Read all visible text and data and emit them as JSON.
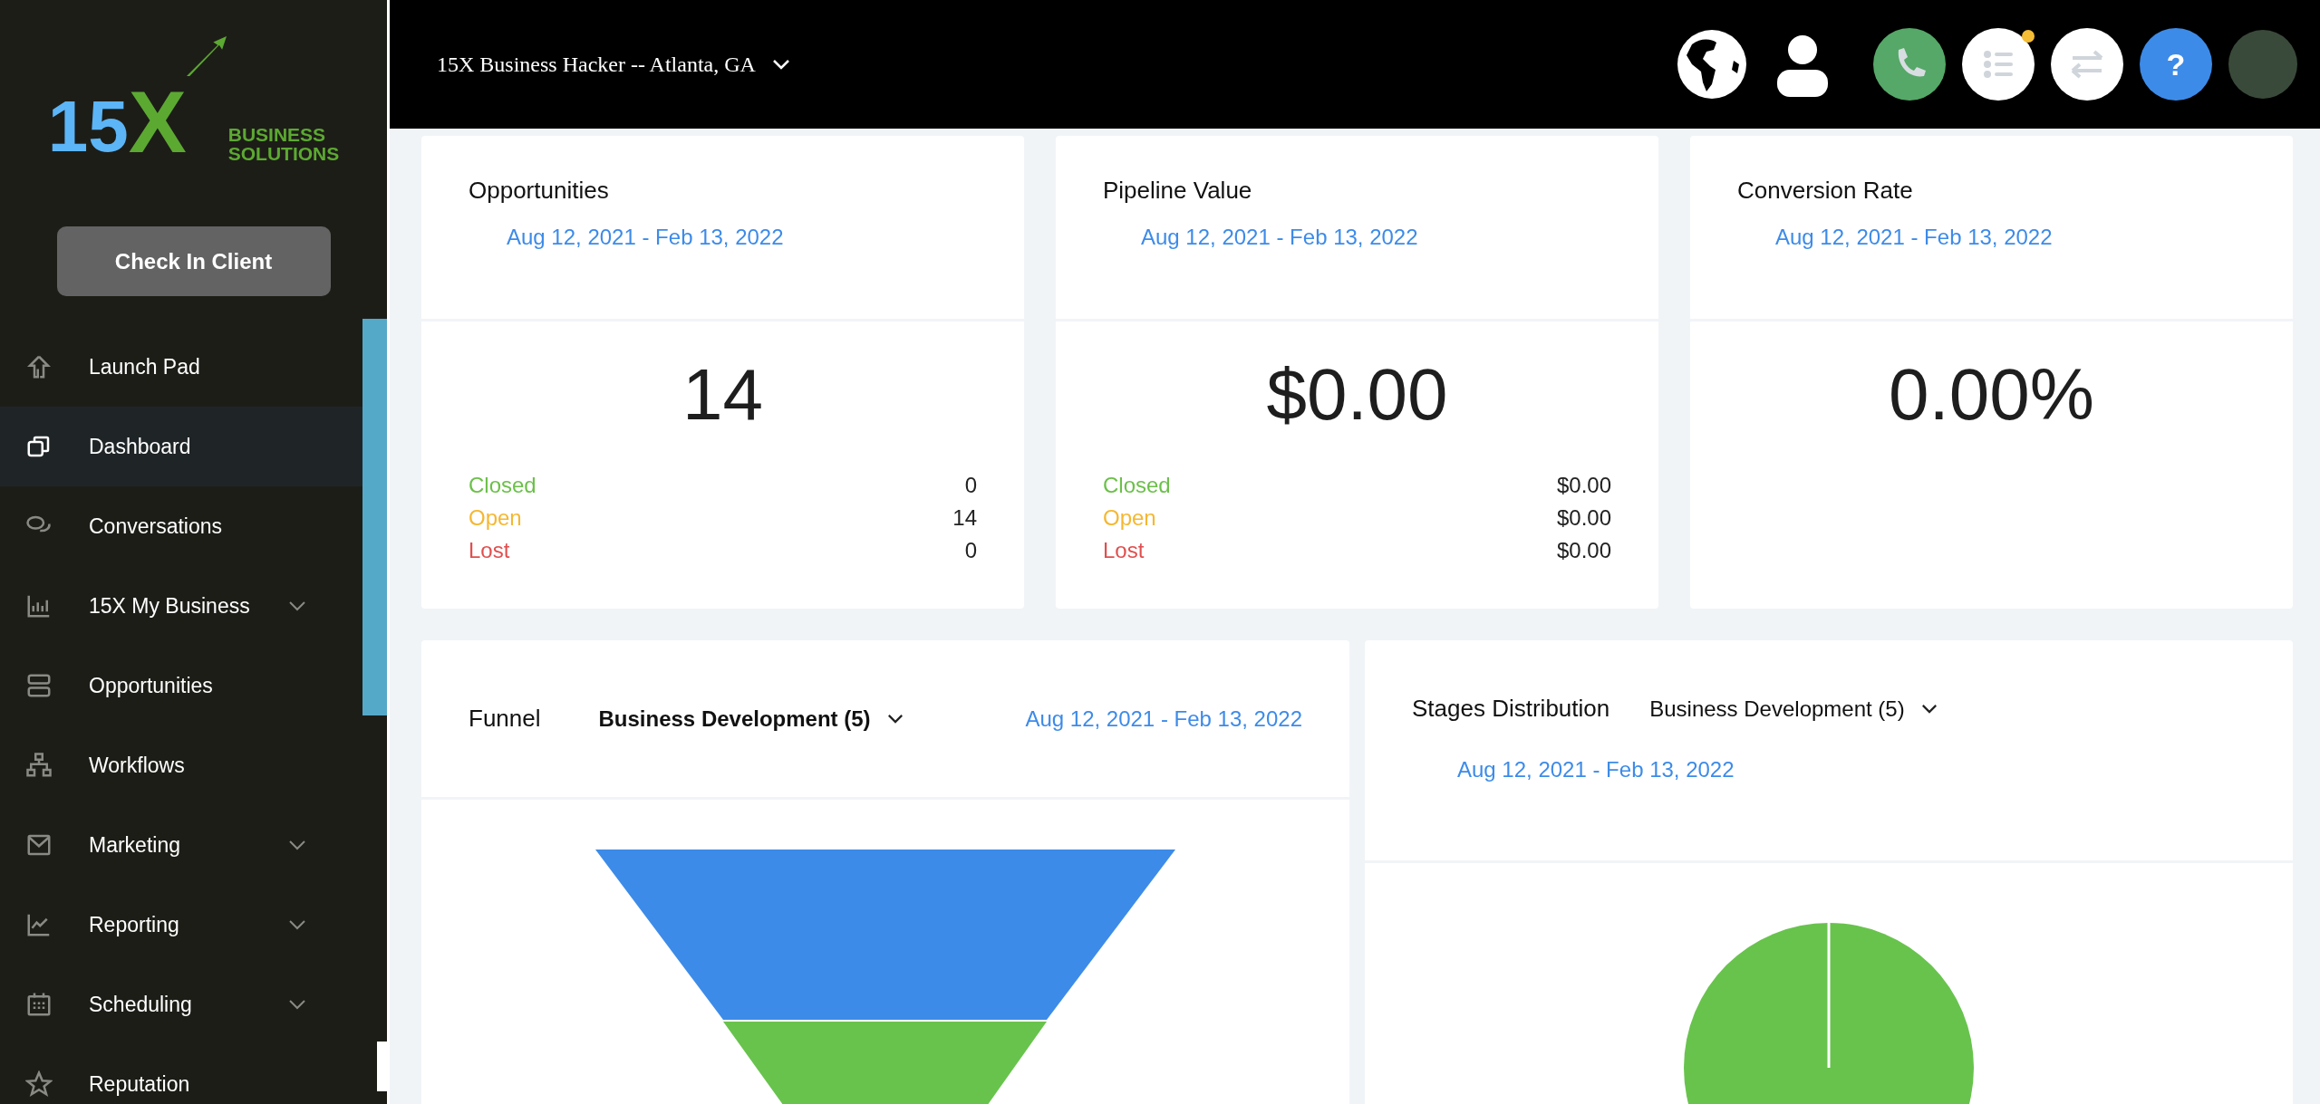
{
  "logo": {
    "prefix": "15",
    "letter": "X",
    "tagline_top": "BUSINESS",
    "tagline_bottom": "SOLUTIONS"
  },
  "check_in_button": "Check In Client",
  "sidebar": {
    "items": [
      {
        "kind": "launch",
        "label": "Launch Pad",
        "selected": false,
        "expandable": false
      },
      {
        "kind": "dashboard",
        "label": "Dashboard",
        "selected": true,
        "expandable": false
      },
      {
        "kind": "conversations",
        "label": "Conversations",
        "selected": false,
        "expandable": false
      },
      {
        "kind": "business",
        "label": "15X My Business",
        "selected": false,
        "expandable": true
      },
      {
        "kind": "opportunities",
        "label": "Opportunities",
        "selected": false,
        "expandable": false
      },
      {
        "kind": "workflows",
        "label": "Workflows",
        "selected": false,
        "expandable": false
      },
      {
        "kind": "marketing",
        "label": "Marketing",
        "selected": false,
        "expandable": true
      },
      {
        "kind": "reporting",
        "label": "Reporting",
        "selected": false,
        "expandable": true
      },
      {
        "kind": "scheduling",
        "label": "Scheduling",
        "selected": false,
        "expandable": true
      },
      {
        "kind": "reputation",
        "label": "Reputation",
        "selected": false,
        "expandable": false
      }
    ]
  },
  "topbar": {
    "location": "15X Business Hacker -- Atlanta, GA",
    "help_label": "?",
    "tasks_badge": true
  },
  "stat_cards": [
    {
      "title": "Opportunities",
      "date_range": "Aug 12, 2021 - Feb 13, 2022",
      "value": "14",
      "breakdown": [
        {
          "label": "Closed",
          "value": "0",
          "color": "#6cc04a"
        },
        {
          "label": "Open",
          "value": "14",
          "color": "#f5b731"
        },
        {
          "label": "Lost",
          "value": "0",
          "color": "#e04f4f"
        }
      ]
    },
    {
      "title": "Pipeline Value",
      "date_range": "Aug 12, 2021 - Feb 13, 2022",
      "value": "$0.00",
      "breakdown": [
        {
          "label": "Closed",
          "value": "$0.00",
          "color": "#6cc04a"
        },
        {
          "label": "Open",
          "value": "$0.00",
          "color": "#f5b731"
        },
        {
          "label": "Lost",
          "value": "$0.00",
          "color": "#e04f4f"
        }
      ]
    },
    {
      "title": "Conversion Rate",
      "date_range": "Aug 12, 2021 - Feb 13, 2022",
      "value": "0.00%"
    }
  ],
  "funnel": {
    "title": "Funnel",
    "pipeline": "Business Development (5)",
    "date_range": "Aug 12, 2021 - Feb 13, 2022"
  },
  "stages": {
    "title": "Stages Distribution",
    "pipeline": "Business Development (5)",
    "date_range": "Aug 12, 2021 - Feb 13, 2022"
  }
}
